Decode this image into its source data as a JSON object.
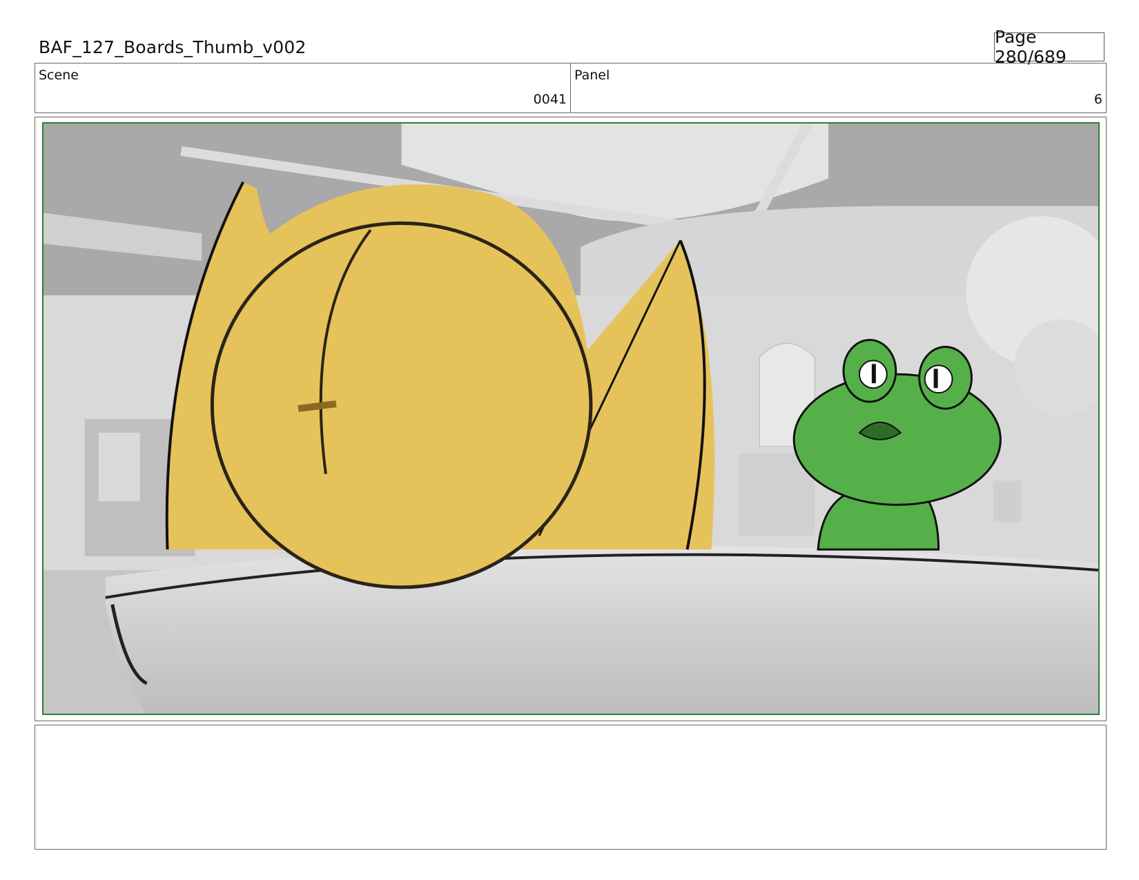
{
  "header": {
    "document_title": "BAF_127_Boards_Thumb_v002",
    "page_label": "Page 280/689"
  },
  "info": {
    "scene_label": "Scene",
    "scene_value": "0041",
    "panel_label": "Panel",
    "panel_value": "6"
  },
  "panel_frame": {
    "border_color": "#2e7d32",
    "background_tone": "#c9c9c9",
    "characters": [
      "yellow-round-character",
      "green-frog-character"
    ],
    "character_colors": {
      "yellow": "#e6c25a",
      "green": "#55b04a"
    }
  },
  "notes": {
    "text": ""
  }
}
